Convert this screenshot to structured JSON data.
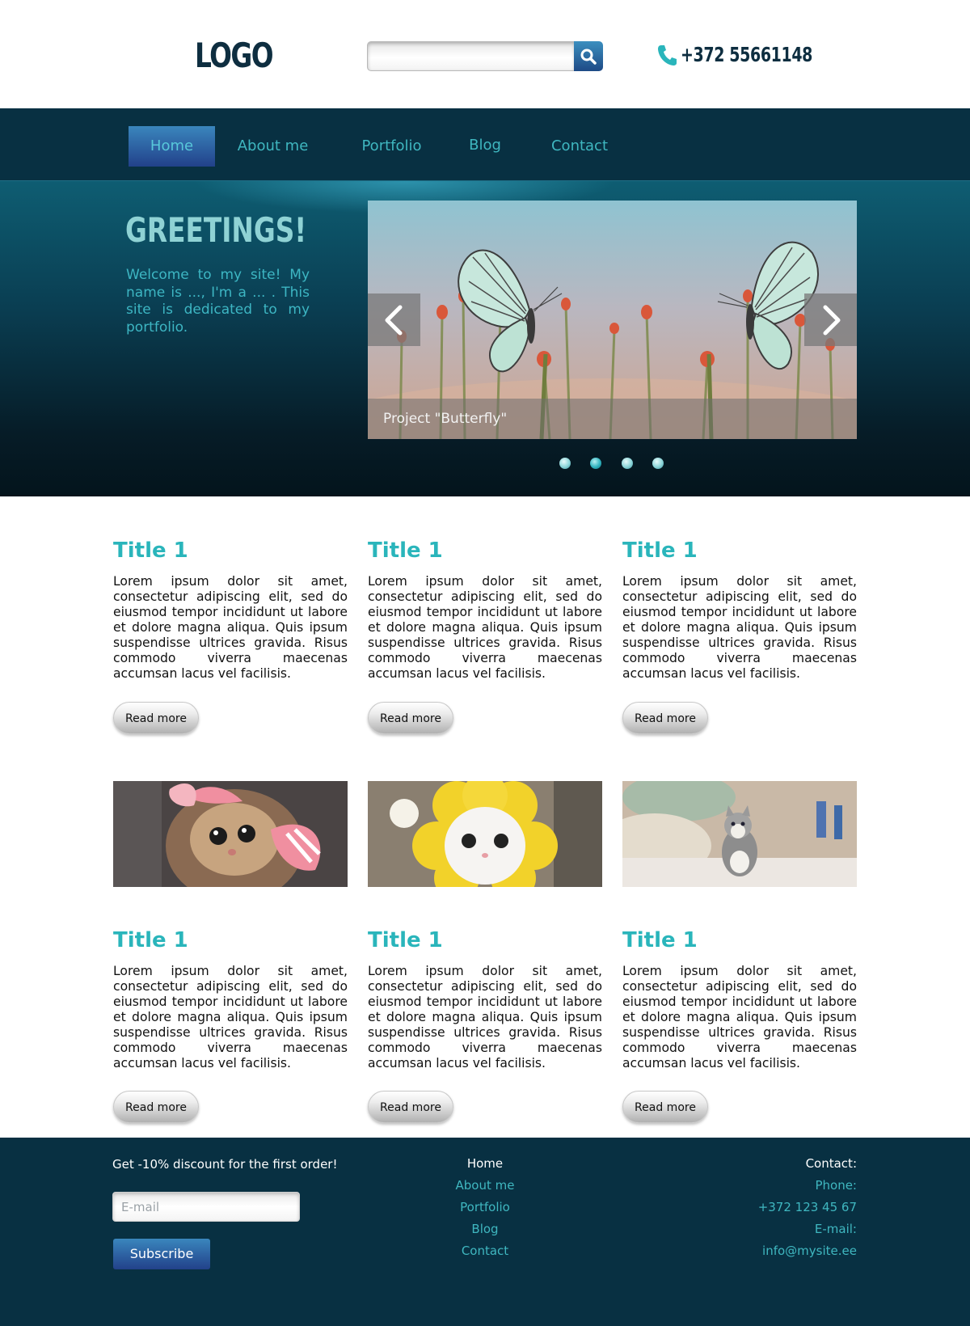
{
  "header": {
    "logo": "LOGO",
    "search": {
      "placeholder": "",
      "icon": "search-icon"
    },
    "phone": "+372 55661148"
  },
  "nav": {
    "items": [
      {
        "label": "Home",
        "active": true
      },
      {
        "label": "About me"
      },
      {
        "label": "Portfolio"
      },
      {
        "label": "Blog"
      },
      {
        "label": "Contact"
      }
    ]
  },
  "hero": {
    "title": "GREETINGS!",
    "text": "Welcome to my site! My name is ..., I'm a ... . This site is dedicated to my portfolio.",
    "slider": {
      "caption": "Project \"Butterfly\"",
      "prev_icon": "chevron-left-icon",
      "next_icon": "chevron-right-icon",
      "dots_count": 4,
      "active_dot": 2
    }
  },
  "content": {
    "row1": [
      {
        "title": "Title 1",
        "text": "Lorem ipsum dolor sit amet, consectetur adipiscing elit, sed do eiusmod tempor incididunt ut labore et dolore magna aliqua. Quis ipsum suspendisse ultrices gravida. Risus commodo viverra maecenas accumsan lacus vel facilisis.",
        "button": "Read more"
      },
      {
        "title": "Title 1",
        "text": "Lorem ipsum dolor sit amet, consectetur adipiscing elit, sed do eiusmod tempor incididunt ut labore et dolore magna aliqua. Quis ipsum suspendisse ultrices gravida. Risus commodo viverra maecenas accumsan lacus vel facilisis.",
        "button": "Read more"
      },
      {
        "title": "Title 1",
        "text": "Lorem ipsum dolor sit amet, consectetur adipiscing elit, sed do eiusmod tempor incididunt ut labore et dolore magna aliqua. Quis ipsum suspendisse ultrices gravida. Risus commodo viverra maecenas accumsan lacus vel facilisis.",
        "button": "Read more"
      }
    ],
    "row2": [
      {
        "title": "Title 1",
        "text": "Lorem ipsum dolor sit amet, consectetur adipiscing elit, sed do eiusmod tempor incididunt ut labore et dolore magna aliqua. Quis ipsum suspendisse ultrices gravida. Risus commodo viverra maecenas accumsan lacus vel facilisis.",
        "button": "Read more"
      },
      {
        "title": "Title 1",
        "text": "Lorem ipsum dolor sit amet, consectetur adipiscing elit, sed do eiusmod tempor incididunt ut labore et dolore magna aliqua. Quis ipsum suspendisse ultrices gravida. Risus commodo viverra maecenas accumsan lacus vel facilisis.",
        "button": "Read more"
      },
      {
        "title": "Title 1",
        "text": "Lorem ipsum dolor sit amet, consectetur adipiscing elit, sed do eiusmod tempor incididunt ut labore et dolore magna aliqua. Quis ipsum suspendisse ultrices gravida. Risus commodo viverra maecenas accumsan lacus vel facilisis.",
        "button": "Read more"
      }
    ]
  },
  "footer": {
    "promo": "Get -10% discount for the first order!",
    "email_placeholder": "E-mail",
    "subscribe": "Subscribe",
    "nav": [
      "Home",
      "About me",
      "Portfolio",
      "Blog",
      "Contact"
    ],
    "contact": {
      "heading": "Contact:",
      "phone_label": "Phone:",
      "phone": "+372 123 45 67",
      "email_label": "E-mail:",
      "email": "info@mysite.ee"
    }
  },
  "colors": {
    "dark_navy": "#083042",
    "accent_teal": "#2ab5bb",
    "button_blue": "#22418a"
  }
}
